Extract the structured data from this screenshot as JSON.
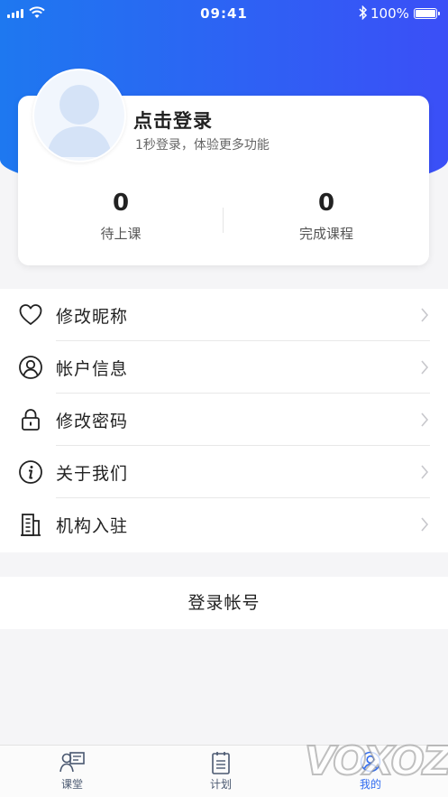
{
  "status_bar": {
    "time": "09:41",
    "battery": "100%"
  },
  "profile": {
    "login_title": "点击登录",
    "login_subtitle": "1秒登录，体验更多功能",
    "stats": [
      {
        "value": "0",
        "label": "待上课"
      },
      {
        "value": "0",
        "label": "完成课程"
      }
    ]
  },
  "menu": {
    "items": [
      {
        "label": "修改昵称",
        "icon": "heart-icon"
      },
      {
        "label": "帐户信息",
        "icon": "user-circle-icon"
      },
      {
        "label": "修改密码",
        "icon": "lock-icon"
      },
      {
        "label": "关于我们",
        "icon": "info-icon"
      },
      {
        "label": "机构入驻",
        "icon": "building-icon"
      }
    ]
  },
  "logout_label": "登录帐号",
  "tabbar": {
    "tabs": [
      {
        "label": "课堂",
        "icon": "classroom-icon",
        "active": false
      },
      {
        "label": "计划",
        "icon": "plan-icon",
        "active": false
      },
      {
        "label": "我的",
        "icon": "profile-icon",
        "active": true
      }
    ]
  },
  "watermark": "VOXOZ",
  "colors": {
    "header_start": "#1e78f0",
    "header_end": "#3b4ff7",
    "tab_active": "#2f6bf0",
    "tab_inactive": "#4a5870"
  }
}
